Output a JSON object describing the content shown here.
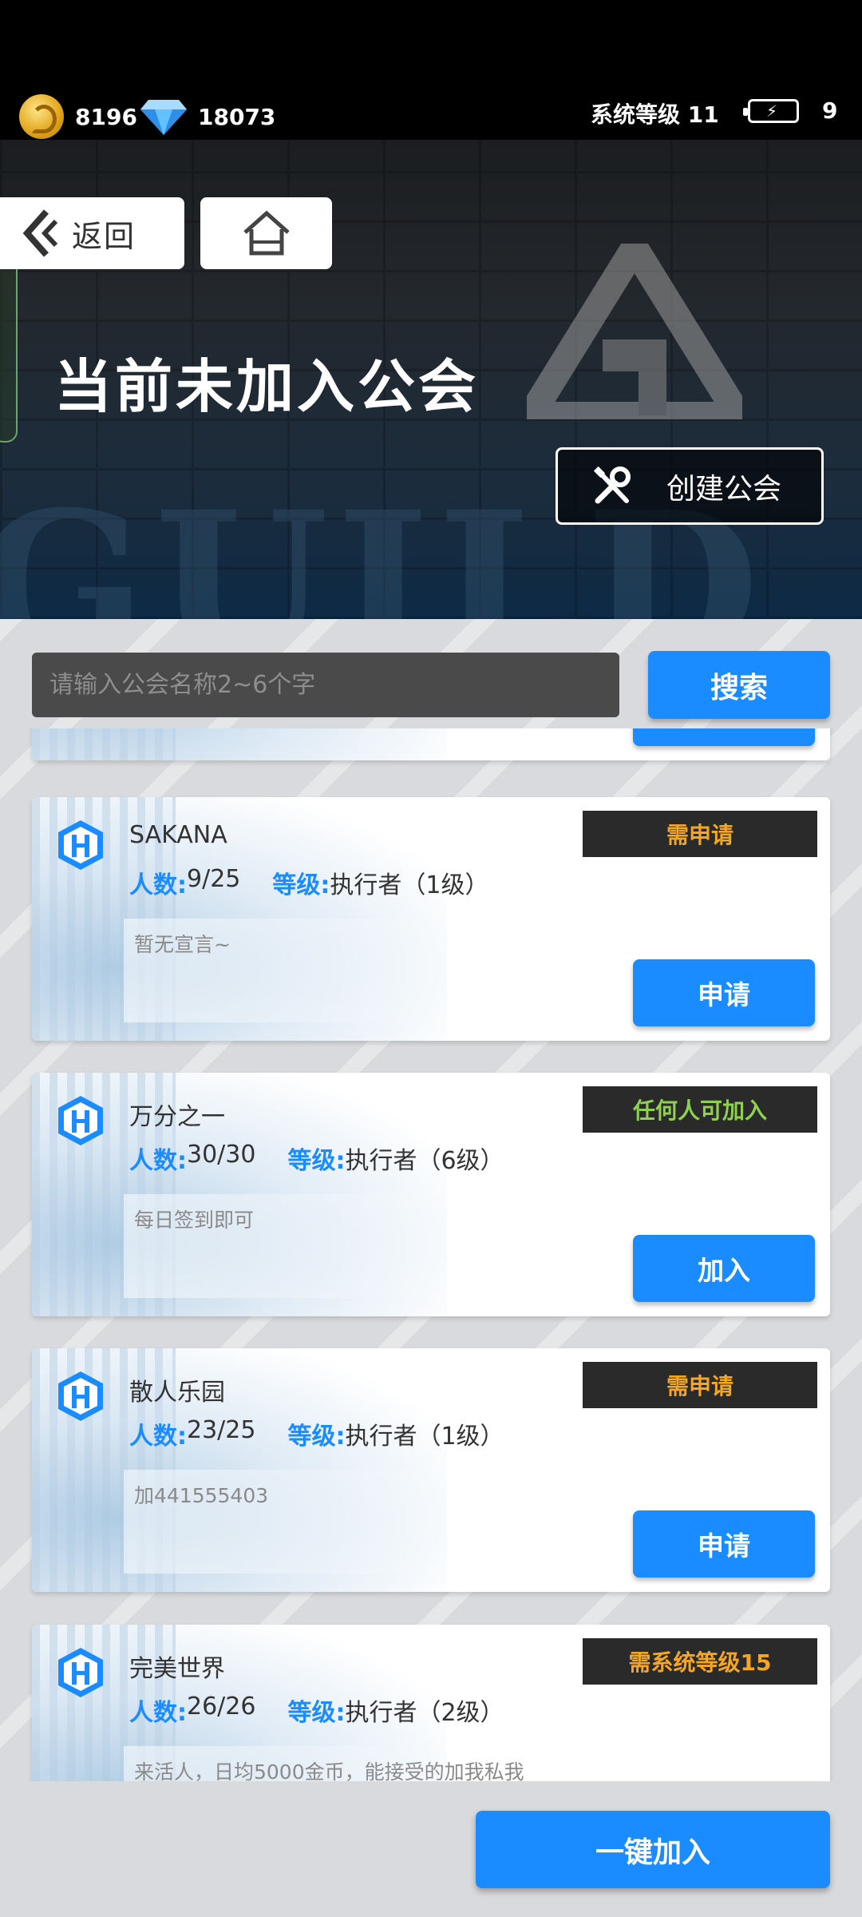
{
  "status": {
    "coins": "8196",
    "gems": "18073",
    "system_level": "系统等级 11",
    "energy": "9"
  },
  "nav": {
    "back_label": "返回"
  },
  "banner": {
    "title": "当前未加入公会",
    "create_label": "创建公会",
    "bg_text": "GUILD"
  },
  "search": {
    "placeholder": "请输入公会名称2~6个字",
    "button_label": "搜索"
  },
  "guilds": [
    {
      "name": "",
      "count_label": "人数:",
      "count": "",
      "level_label": "等级:",
      "level": "",
      "desc": "",
      "badge": "",
      "badge_color": "#f5a623",
      "action": ""
    },
    {
      "name": "SAKANA",
      "count_label": "人数:",
      "count": "9/25",
      "level_label": "等级:",
      "level": "执行者（1级）",
      "desc": "暂无宣言~",
      "badge": "需申请",
      "badge_color": "#f5a623",
      "action": "申请"
    },
    {
      "name": "万分之一",
      "count_label": "人数:",
      "count": "30/30",
      "level_label": "等级:",
      "level": "执行者（6级）",
      "desc": "每日签到即可",
      "badge": "任何人可加入",
      "badge_color": "#8fd14f",
      "action": "加入"
    },
    {
      "name": "散人乐园",
      "count_label": "人数:",
      "count": "23/25",
      "level_label": "等级:",
      "level": "执行者（1级）",
      "desc": "加441555403",
      "badge": "需申请",
      "badge_color": "#f5a623",
      "action": "申请"
    },
    {
      "name": "完美世界",
      "count_label": "人数:",
      "count": "26/26",
      "level_label": "等级:",
      "level": "执行者（2级）",
      "desc": "来活人，日均5000金币，能接受的加我私我",
      "badge": "需系统等级15",
      "badge_color": "#f5a623",
      "action": ""
    }
  ],
  "footer": {
    "one_key_join": "一键加入"
  }
}
